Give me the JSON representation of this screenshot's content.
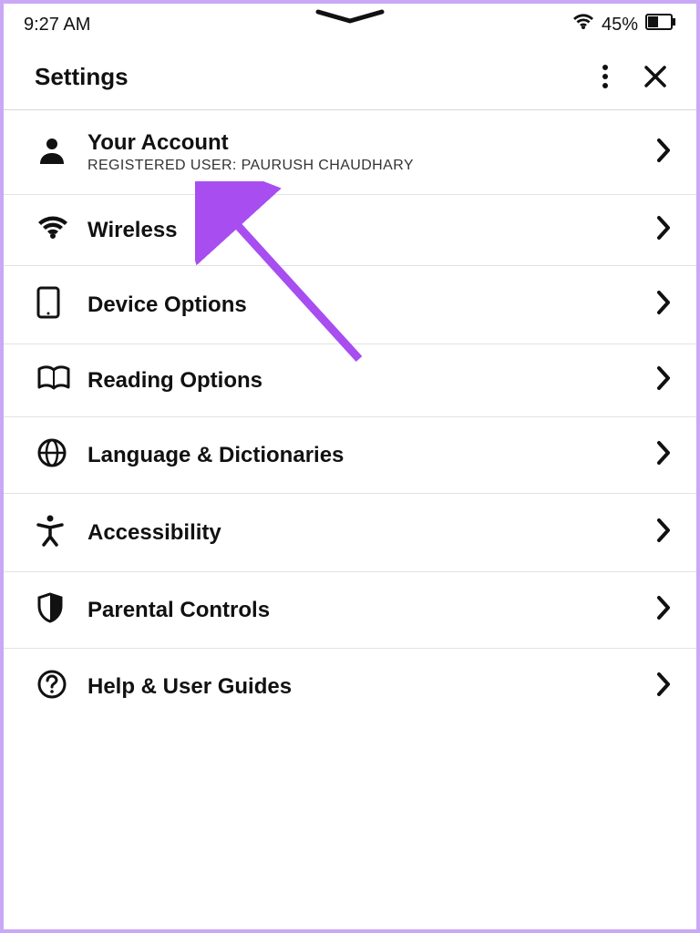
{
  "status": {
    "time": "9:27 AM",
    "battery_pct": "45%"
  },
  "header": {
    "title": "Settings"
  },
  "rows": {
    "account": {
      "title": "Your Account",
      "subtitle": "REGISTERED USER: PAURUSH CHAUDHARY"
    },
    "wireless": {
      "title": "Wireless"
    },
    "device": {
      "title": "Device Options"
    },
    "reading": {
      "title": "Reading Options"
    },
    "language": {
      "title": "Language & Dictionaries"
    },
    "accessibility": {
      "title": "Accessibility"
    },
    "parental": {
      "title": "Parental Controls"
    },
    "help": {
      "title": "Help & User Guides"
    }
  }
}
